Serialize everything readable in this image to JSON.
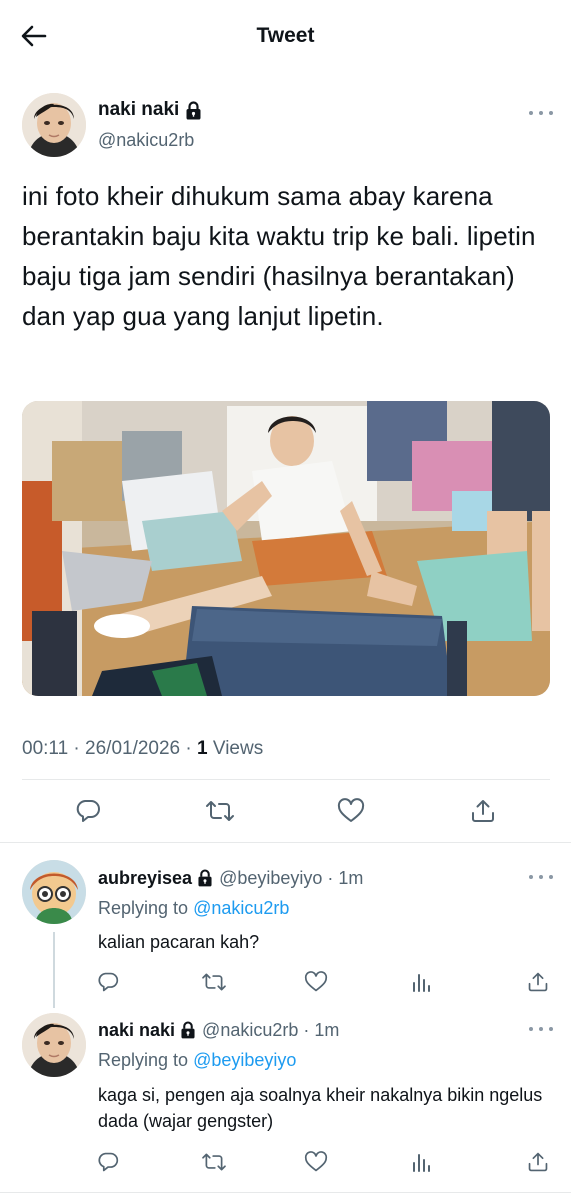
{
  "header": {
    "title": "Tweet"
  },
  "tweet": {
    "author": {
      "name": "naki naki",
      "handle": "@nakicu2rb"
    },
    "text": "ini foto kheir dihukum sama abay karena berantakin baju kita waktu trip ke bali. lipetin baju tiga jam sendiri (hasilnya berantakan) dan yap gua yang lanjut lipetin.",
    "time": "00:11",
    "sep": "·",
    "date": "26/01/2026",
    "views_count": "1",
    "views_label": "Views"
  },
  "replies": [
    {
      "name": "aubreyisea",
      "handle": "@beyibeyiyo",
      "sep": "·",
      "time": "1m",
      "replying_prefix": "Replying to",
      "replying_to": "@nakicu2rb",
      "text": "kalian pacaran kah?"
    },
    {
      "name": "naki naki",
      "handle": "@nakicu2rb",
      "sep": "·",
      "time": "1m",
      "replying_prefix": "Replying to",
      "replying_to": "@beyibeyiyo",
      "text": "kaga si, pengen aja soalnya kheir nakalnya bikin ngelus dada (wajar gengster)"
    }
  ],
  "icons": {
    "back": "arrow-left-icon",
    "lock": "lock-icon",
    "more": "more-dots-icon",
    "reply": "reply-icon",
    "retweet": "retweet-icon",
    "like": "heart-icon",
    "share": "share-icon",
    "analytics": "analytics-icon"
  },
  "colors": {
    "link": "#1d9bf0",
    "secondary": "#536471",
    "text": "#0f1419",
    "divider": "#e7e9ea"
  }
}
